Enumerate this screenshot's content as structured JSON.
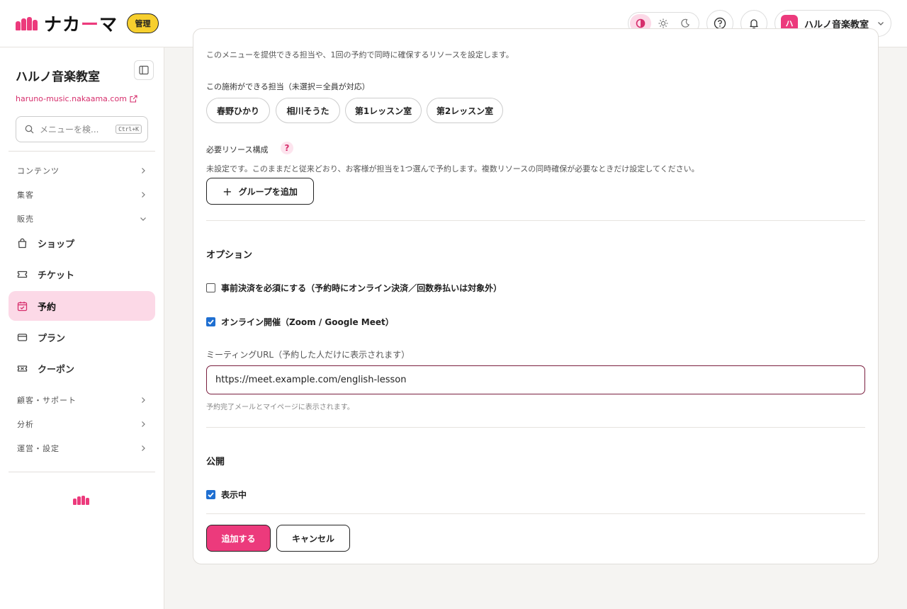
{
  "header": {
    "logo_text_a": "ナカ",
    "logo_text_dash": "ー",
    "logo_text_b": "マ",
    "admin_badge": "管理",
    "account": {
      "avatar": "ハ",
      "name": "ハルノ音楽教室"
    }
  },
  "sidebar": {
    "title": "ハルノ音楽教室",
    "url": "haruno-music.nakaama.com",
    "search_placeholder": "メニューを検...",
    "search_shortcut": "Ctrl+K",
    "groups": {
      "contents": "コンテンツ",
      "marketing": "集客",
      "sales": "販売",
      "customers": "顧客・サポート",
      "analytics": "分析",
      "operations": "運営・設定"
    },
    "items": {
      "shop": "ショップ",
      "ticket": "チケット",
      "reservation": "予約",
      "plan": "プラン",
      "coupon": "クーポン"
    }
  },
  "form": {
    "resource_desc": "このメニューを提供できる担当や、1回の予約で同時に確保するリソースを設定します。",
    "staff_label": "この施術ができる担当（未選択＝全員が対応）",
    "staff_chips": [
      "春野ひかり",
      "相川そうた",
      "第1レッスン室",
      "第2レッスン室"
    ],
    "resource_label": "必要リソース構成",
    "resource_help": "?",
    "resource_note": "未設定です。このままだと従来どおり、お客様が担当を1つ選んで予約します。複数リソースの同時確保が必要なときだけ設定してください。",
    "add_group": "グループを追加",
    "add_group_plus": "+",
    "options_title": "オプション",
    "prepay_label": "事前決済を必須にする（予約時にオンライン決済／回数券払いは対象外）",
    "prepay_checked": false,
    "online_label": "オンライン開催（Zoom / Google Meet）",
    "online_checked": true,
    "meeting_url_label": "ミーティングURL（予約した人だけに表示されます）",
    "meeting_url_value": "https://meet.example.com/english-lesson",
    "meeting_url_hint": "予約完了メールとマイページに表示されます。",
    "publish_title": "公開",
    "visible_label": "表示中",
    "visible_checked": true,
    "submit": "追加する",
    "cancel": "キャンセル"
  },
  "colors": {
    "brand": "#ec3a7c",
    "active_bg": "#fcd9e7",
    "badge_yellow": "#f7cf2e",
    "checkbox_blue": "#1f6fd1"
  }
}
